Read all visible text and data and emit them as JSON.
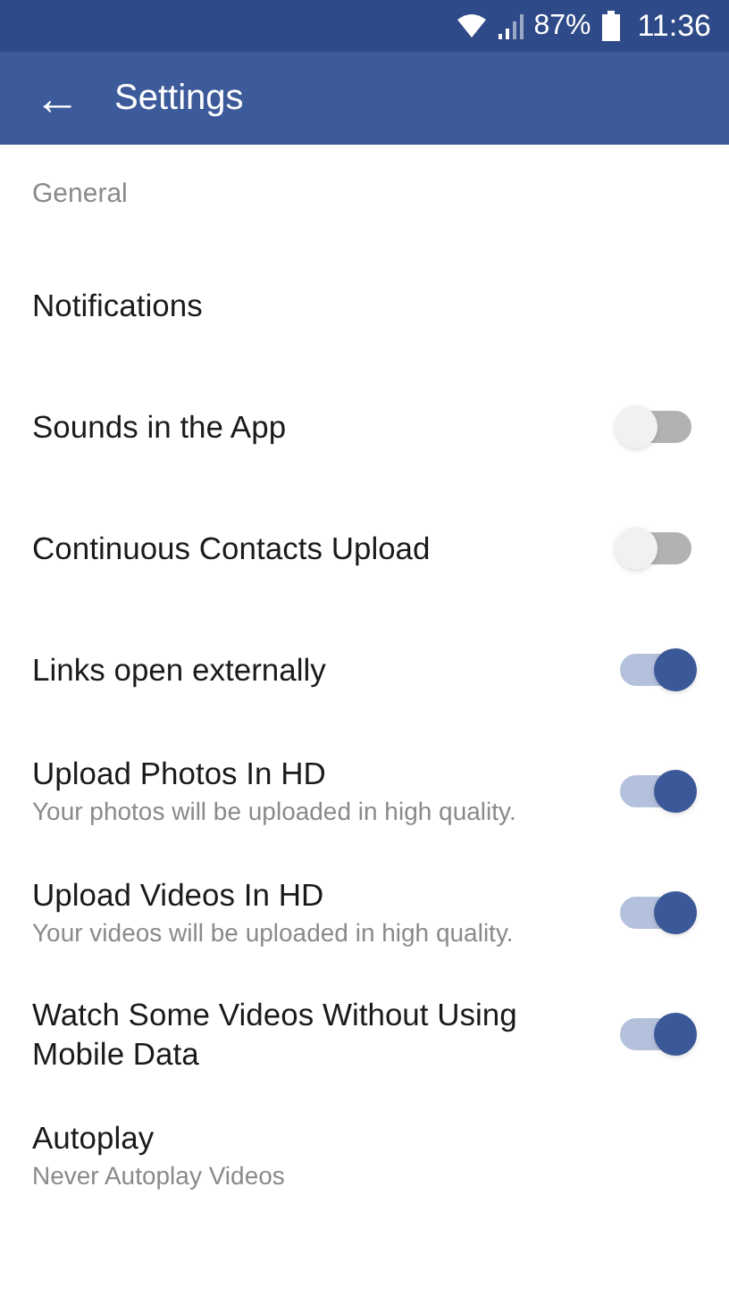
{
  "status_bar": {
    "battery": "87%",
    "time": "11:36"
  },
  "app_bar": {
    "back": "←",
    "title": "Settings"
  },
  "section": "General",
  "items": [
    {
      "kind": "link",
      "label": "Notifications"
    },
    {
      "kind": "toggle",
      "label": "Sounds in the App",
      "on": false
    },
    {
      "kind": "toggle",
      "label": "Continuous Contacts Upload",
      "on": false
    },
    {
      "kind": "toggle",
      "label": "Links open externally",
      "on": true
    },
    {
      "kind": "toggle",
      "label": "Upload Photos In HD",
      "subtitle": "Your photos will be uploaded in high quality.",
      "on": true
    },
    {
      "kind": "toggle",
      "label": "Upload Videos In HD",
      "subtitle": "Your videos will be uploaded in high quality.",
      "on": true
    },
    {
      "kind": "toggle",
      "label": "Watch Some Videos Without Using Mobile Data",
      "on": true
    },
    {
      "kind": "link",
      "label": "Autoplay",
      "subtitle": "Never Autoplay Videos"
    }
  ]
}
